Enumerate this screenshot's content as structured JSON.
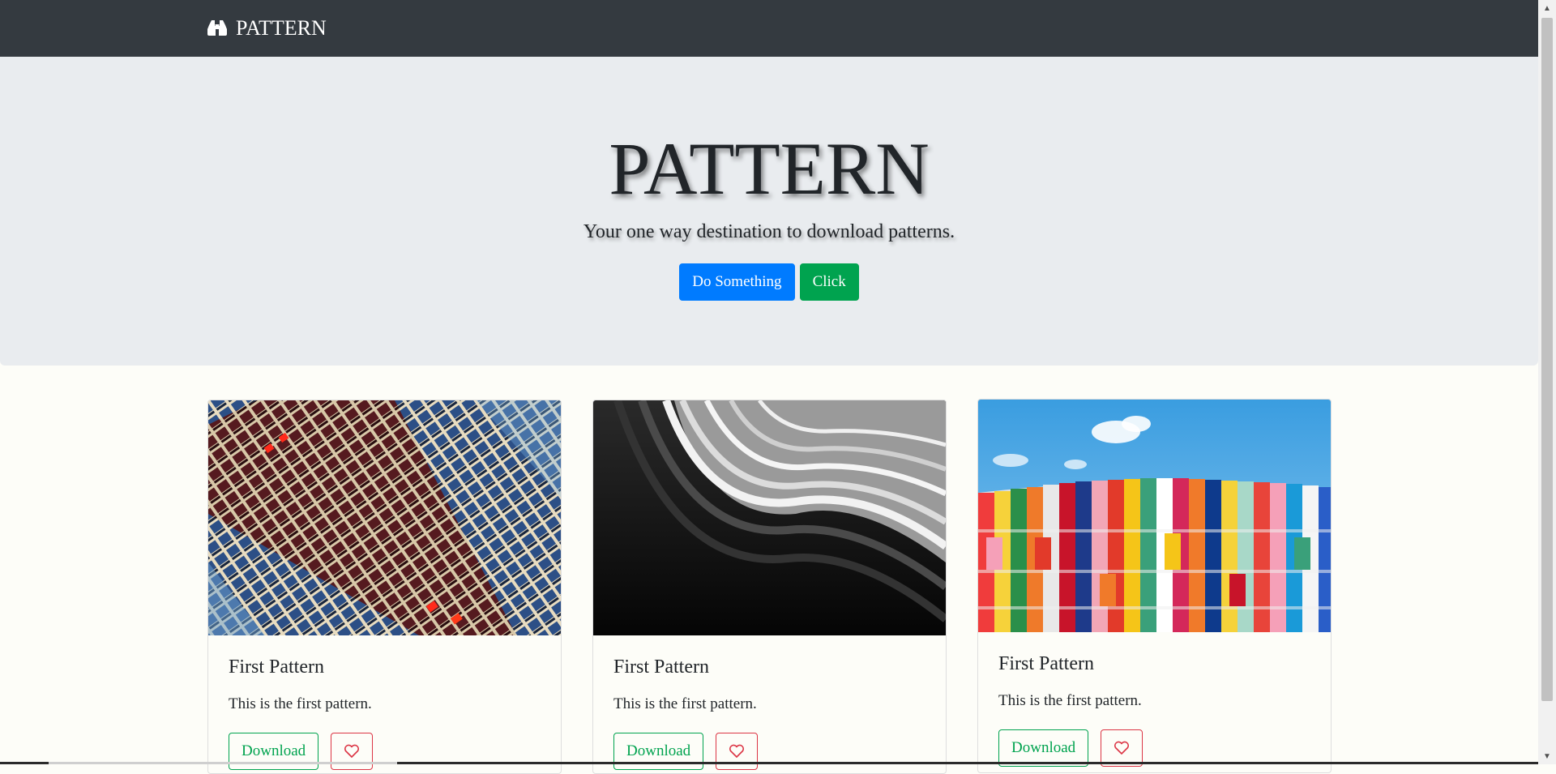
{
  "navbar": {
    "brand_icon": "binoculars-icon",
    "brand_label": "PATTERN"
  },
  "hero": {
    "title": "PATTERN",
    "subtitle": "Your one way destination to download patterns.",
    "primary_button": "Do Something",
    "secondary_button": "Click"
  },
  "cards": [
    {
      "title": "First Pattern",
      "text": "This is the first pattern.",
      "download_label": "Download",
      "like_icon": "heart-icon"
    },
    {
      "title": "First Pattern",
      "text": "This is the first pattern.",
      "download_label": "Download",
      "like_icon": "heart-icon"
    },
    {
      "title": "First Pattern",
      "text": "This is the first pattern.",
      "download_label": "Download",
      "like_icon": "heart-icon"
    }
  ],
  "colors": {
    "navbar": "#343a40",
    "hero_bg": "#e9ecef",
    "primary": "#007bff",
    "success": "#00a34f",
    "danger": "#dc3545"
  }
}
